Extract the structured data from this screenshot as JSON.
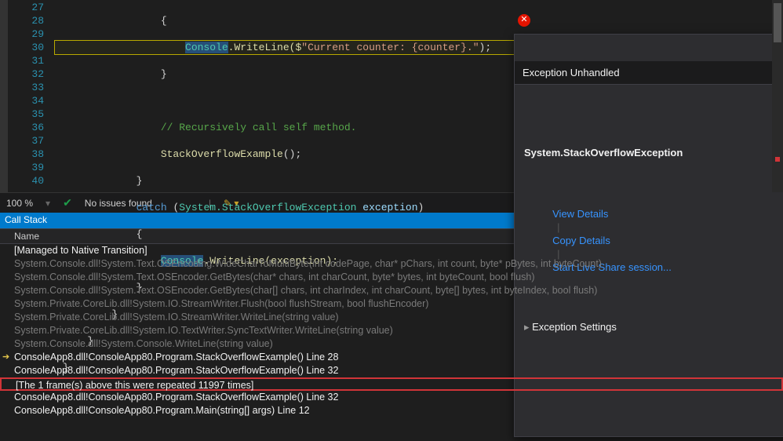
{
  "editor": {
    "lines": [
      27,
      28,
      29,
      30,
      31,
      32,
      33,
      34,
      35,
      36,
      37,
      38,
      39,
      40
    ],
    "code28_prefix": "                    ",
    "code28_console": "Console",
    "code28_writeln": ".WriteLine($",
    "code28_str": "\"Current counter: {counter}.\"",
    "code28_close": ");",
    "code31_comment": "// Recursively call self method.",
    "code32_call": "StackOverflowExample",
    "code32_close": "();",
    "code34_catch": "catch",
    "code34_open": " (",
    "code34_ns": "System.StackOverflowException",
    "code34_var": " exception",
    "code34_close": ")",
    "code36_console": "Console",
    "code36_writeln": ".WriteLine(exception);"
  },
  "exception": {
    "title": "Exception Unhandled",
    "name": "System.StackOverflowException",
    "link_view": "View Details",
    "link_copy": "Copy Details",
    "link_live": "Start Live Share session...",
    "settings": "Exception Settings"
  },
  "status": {
    "zoom": "100 %",
    "issues": "No issues found"
  },
  "callstack": {
    "title": "Call Stack",
    "col_name": "Name",
    "rows": [
      {
        "text": "[Managed to Native Transition]",
        "user": true
      },
      {
        "text": "System.Console.dll!System.Text.OSEncoding.WideCharToMultiByte(int codePage, char* pChars, int count, byte* pBytes, int byteCount)"
      },
      {
        "text": "System.Console.dll!System.Text.OSEncoder.GetBytes(char* chars, int charCount, byte* bytes, int byteCount, bool flush)"
      },
      {
        "text": "System.Console.dll!System.Text.OSEncoder.GetBytes(char[] chars, int charIndex, int charCount, byte[] bytes, int byteIndex, bool flush)"
      },
      {
        "text": "System.Private.CoreLib.dll!System.IO.StreamWriter.Flush(bool flushStream, bool flushEncoder)"
      },
      {
        "text": "System.Private.CoreLib.dll!System.IO.StreamWriter.WriteLine(string value)"
      },
      {
        "text": "System.Private.CoreLib.dll!System.IO.TextWriter.SyncTextWriter.WriteLine(string value)"
      },
      {
        "text": "System.Console.dll!System.Console.WriteLine(string value)"
      },
      {
        "text": "ConsoleApp8.dll!ConsoleApp80.Program.StackOverflowExample() Line 28",
        "user": true,
        "arrow": true
      },
      {
        "text": "ConsoleApp8.dll!ConsoleApp80.Program.StackOverflowExample() Line 32",
        "user": true
      },
      {
        "text": "[The 1 frame(s) above this were repeated 11997 times]",
        "user": true,
        "redbox": true
      },
      {
        "text": "ConsoleApp8.dll!ConsoleApp80.Program.StackOverflowExample() Line 32",
        "user": true
      },
      {
        "text": "ConsoleApp8.dll!ConsoleApp80.Program.Main(string[] args) Line 12",
        "user": true
      }
    ]
  }
}
